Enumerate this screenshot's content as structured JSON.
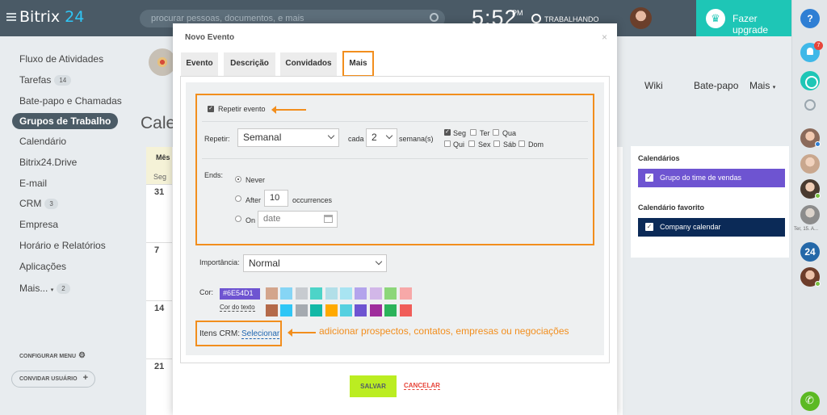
{
  "header": {
    "logo_text": "Bitrix",
    "logo_num": "24",
    "search_placeholder": "procurar pessoas, documentos, e mais",
    "clock": "5:52",
    "clock_ampm": "PM",
    "status": "TRABALHANDO",
    "upgrade_label": "Fazer upgrade"
  },
  "rail": {
    "help": "?",
    "notif_count": "7",
    "date_label": "Ter, 15. A...",
    "b24": "24"
  },
  "sidebar": {
    "items": [
      {
        "label": "Fluxo de Atividades"
      },
      {
        "label": "Tarefas",
        "count": "14"
      },
      {
        "label": "Bate-papo e Chamadas"
      },
      {
        "label": "Grupos de Trabalho"
      },
      {
        "label": "Calendário"
      },
      {
        "label": "Bitrix24.Drive"
      },
      {
        "label": "E-mail"
      },
      {
        "label": "CRM",
        "count": "3"
      },
      {
        "label": "Empresa"
      },
      {
        "label": "Horário e Relatórios"
      },
      {
        "label": "Aplicações"
      },
      {
        "label": "Mais...",
        "count": "2"
      }
    ],
    "configure_menu": "CONFIGURAR MENU",
    "invite": "CONVIDAR USUÁRIO"
  },
  "page": {
    "subnav": [
      "Wiki",
      "Bate-papo",
      "Mais"
    ],
    "title": "Calen",
    "cal_tab": "Mês",
    "weekday": "Seg",
    "days": [
      "31",
      "7",
      "14",
      "21"
    ]
  },
  "calendars": {
    "title": "Calendários",
    "item": "Grupo do time de vendas",
    "item_color": "#6e54d1",
    "fav_title": "Calendário favorito",
    "fav_item": "Company calendar",
    "fav_color": "#0b2a57"
  },
  "modal": {
    "title": "Novo Evento",
    "tabs": [
      "Evento",
      "Descrição",
      "Convidados",
      "Mais"
    ],
    "repeat_label": "Repetir evento",
    "repetir_label": "Repetir:",
    "frequency": "Semanal",
    "cada_label": "cada",
    "interval": "2",
    "interval_unit": "semana(s)",
    "weekdays": [
      {
        "label": "Seg",
        "checked": true
      },
      {
        "label": "Ter",
        "checked": false
      },
      {
        "label": "Qua",
        "checked": false
      },
      {
        "label": "Qui",
        "checked": false
      },
      {
        "label": "Sex",
        "checked": false
      },
      {
        "label": "Sáb",
        "checked": false
      },
      {
        "label": "Dom",
        "checked": false
      }
    ],
    "ends_label": "Ends:",
    "ends_never": "Never",
    "ends_after": "After",
    "ends_after_value": "10",
    "ends_occurrences": "occurrences",
    "ends_on": "On",
    "date_placeholder": "date",
    "importance_label": "Importância:",
    "importance": "Normal",
    "color_label": "Cor:",
    "color_value": "#6E54D1",
    "text_color_link": "Cor do texto",
    "swatches_row1": [
      "#d3a58c",
      "#86d5f5",
      "#c7cbd0",
      "#4dd4c8",
      "#b2dfe8",
      "#a8e4f2",
      "#b3a4ec",
      "#d2b7e8",
      "#8cd67a",
      "#f7a8a8"
    ],
    "swatches_row2": [
      "#b46a4a",
      "#2fc6f6",
      "#a4aab0",
      "#13b8a6",
      "#ffa900",
      "#55d0e0",
      "#6e54d1",
      "#9f2d9c",
      "#2bb35a",
      "#f05d59"
    ],
    "crm_label": "Itens CRM:",
    "crm_link": "Selecionar",
    "annotation": "adicionar prospectos, contatos, empresas ou negociações",
    "save": "SALVAR",
    "cancel": "CANCELAR"
  }
}
